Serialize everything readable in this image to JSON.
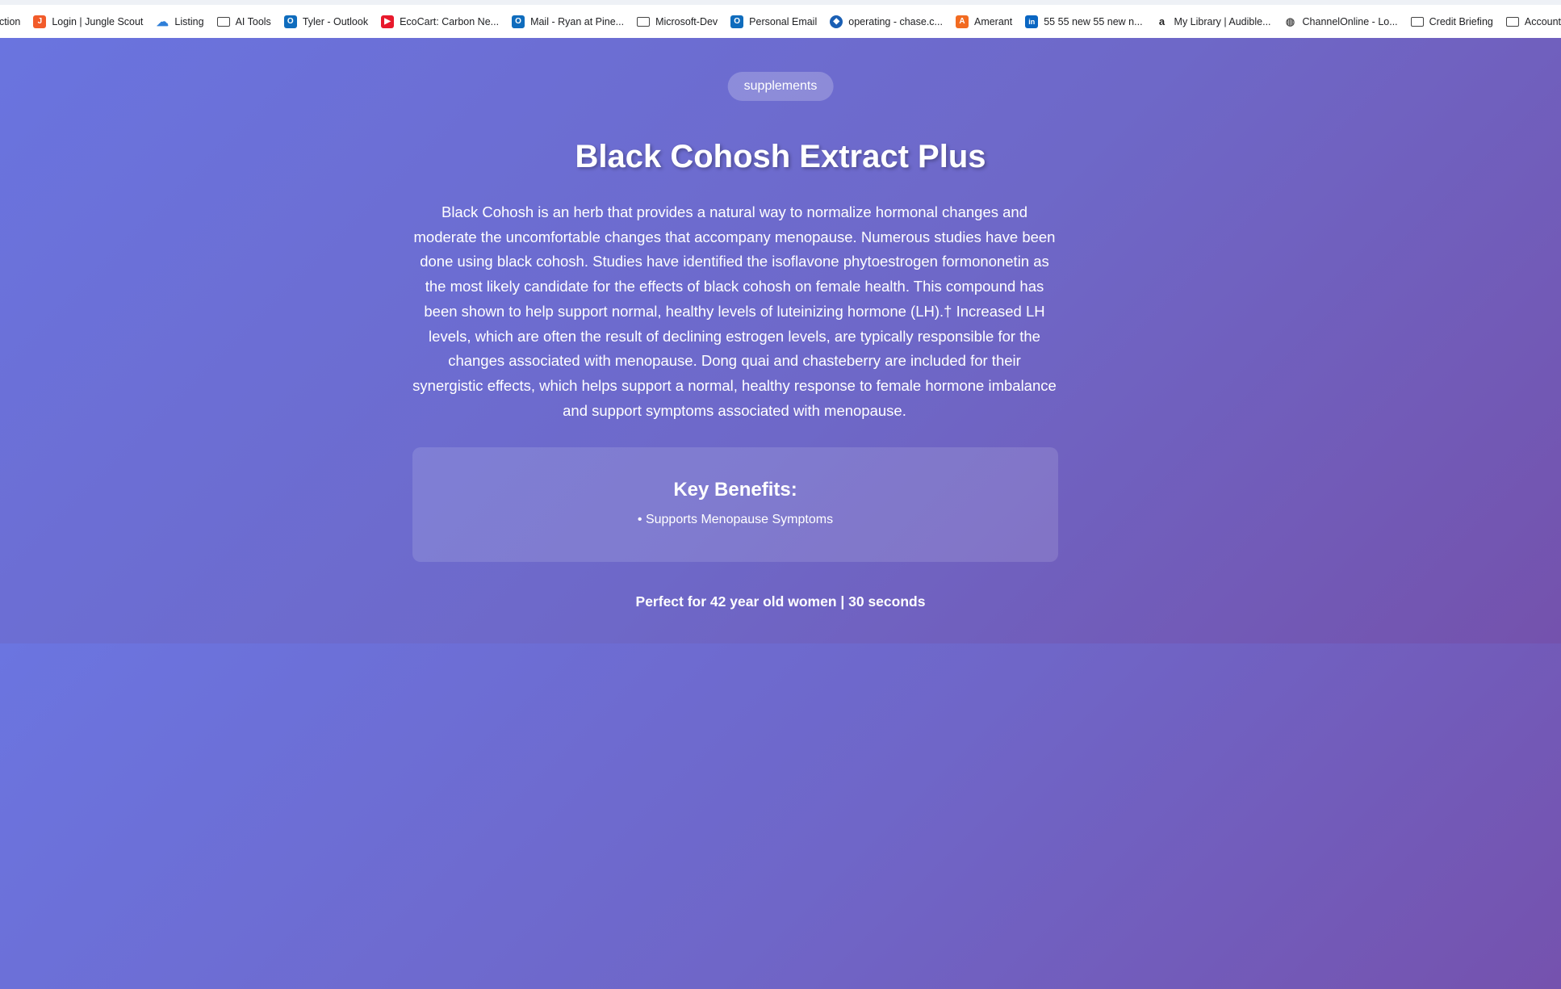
{
  "bookmarks": [
    {
      "label": "uction",
      "icon": "none"
    },
    {
      "label": "Login | Jungle Scout",
      "icon": "jungle-scout-icon",
      "color": "#f25b2a"
    },
    {
      "label": "Listing",
      "icon": "cloud-icon",
      "color": "#2f7fd8"
    },
    {
      "label": "AI Tools",
      "icon": "folder-icon"
    },
    {
      "label": "Tyler - Outlook",
      "icon": "outlook-icon",
      "color": "#0f6cbd"
    },
    {
      "label": "EcoCart: Carbon Ne...",
      "icon": "youtube-icon",
      "color": "#e8192c"
    },
    {
      "label": "Mail - Ryan at Pine...",
      "icon": "outlook-icon",
      "color": "#0f6cbd"
    },
    {
      "label": "Microsoft-Dev",
      "icon": "folder-icon"
    },
    {
      "label": "Personal Email",
      "icon": "outlook-icon",
      "color": "#0f6cbd"
    },
    {
      "label": "operating - chase.c...",
      "icon": "chase-icon",
      "color": "#1a5fb4"
    },
    {
      "label": "Amerant",
      "icon": "amerant-icon",
      "color": "#f26b21"
    },
    {
      "label": "55 55 new 55 new n...",
      "icon": "linkedin-icon",
      "color": "#0a66c2"
    },
    {
      "label": "My Library | Audible...",
      "icon": "amazon-icon",
      "color": "#222222"
    },
    {
      "label": "ChannelOnline - Lo...",
      "icon": "globe-icon",
      "color": "#555555"
    },
    {
      "label": "Credit Briefing",
      "icon": "folder-icon"
    },
    {
      "label": "Accounting-Am",
      "icon": "folder-icon"
    }
  ],
  "product": {
    "category": "supplements",
    "title": "Black Cohosh Extract Plus",
    "description": "Black Cohosh is an herb that provides a natural way to normalize hormonal changes and moderate the uncomfortable changes that accompany menopause. Numerous studies have been done using black cohosh. Studies have identified the isoflavone phytoestrogen formononetin as the most likely candidate for the effects of black cohosh on female health. This compound has been shown to help support normal, healthy levels of luteinizing hormone (LH).† Increased LH levels, which are often the result of declining estrogen levels, are typically responsible for the changes associated with menopause. Dong quai and chasteberry are included for their synergistic effects, which helps support a normal, healthy response to female hormone imbalance and support symptoms associated with menopause.",
    "benefits_heading": "Key Benefits:",
    "benefits": [
      "• Supports Menopause Symptoms"
    ],
    "footer": "Perfect for 42 year old women | 30 seconds"
  },
  "colors": {
    "gradient_start": "#6a74df",
    "gradient_end": "#7452ad"
  }
}
